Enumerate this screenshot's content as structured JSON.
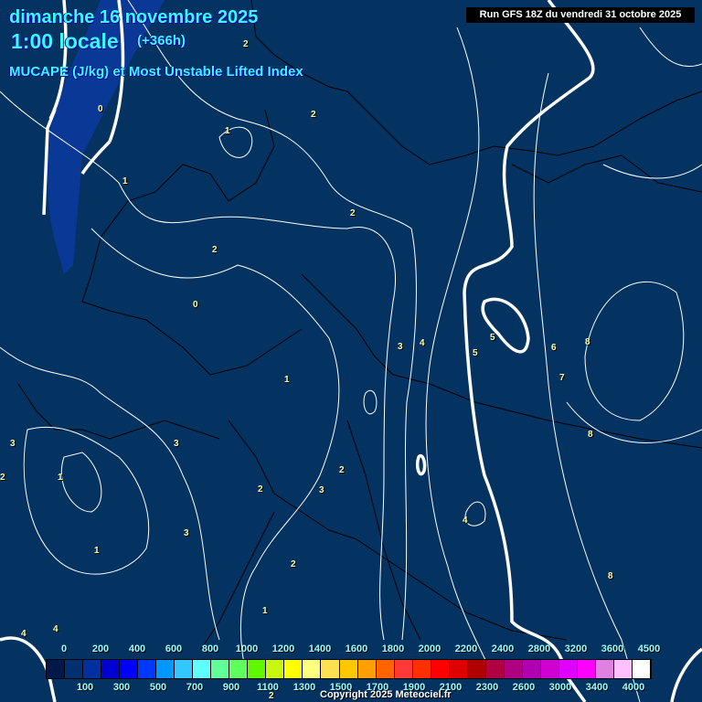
{
  "header": {
    "date": "dimanche 16 novembre 2025",
    "time": "1:00 locale",
    "lead": "(+366h)",
    "parameter": "MUCAPE (J/kg) et Most Unstable Lifted Index",
    "run": "Run GFS 18Z du vendredi 31 octobre 2025"
  },
  "contour_labels": [
    {
      "t": "2"
    },
    {
      "t": "0"
    },
    {
      "t": "2"
    },
    {
      "t": "1"
    },
    {
      "t": "1"
    },
    {
      "t": "2"
    },
    {
      "t": "2"
    },
    {
      "t": "0"
    },
    {
      "t": "1"
    },
    {
      "t": "3"
    },
    {
      "t": "4"
    },
    {
      "t": "5"
    },
    {
      "t": "5"
    },
    {
      "t": "6"
    },
    {
      "t": "8"
    },
    {
      "t": "7"
    },
    {
      "t": "8"
    },
    {
      "t": "3"
    },
    {
      "t": "3"
    },
    {
      "t": "1"
    },
    {
      "t": "2"
    },
    {
      "t": "2"
    },
    {
      "t": "2"
    },
    {
      "t": "3"
    },
    {
      "t": "3"
    },
    {
      "t": "1"
    },
    {
      "t": "2"
    },
    {
      "t": "4"
    },
    {
      "t": "8"
    },
    {
      "t": "1"
    },
    {
      "t": "4"
    },
    {
      "t": "4"
    },
    {
      "t": "2"
    }
  ],
  "legend": {
    "colors": [
      "#001848",
      "#003070",
      "#0030a0",
      "#0000d0",
      "#0000ff",
      "#0038ff",
      "#0098ff",
      "#30c8ff",
      "#60ffff",
      "#60ff98",
      "#60ff60",
      "#60f800",
      "#c8f810",
      "#ffff00",
      "#ffff80",
      "#ffe050",
      "#ffc800",
      "#ffa000",
      "#ff6400",
      "#ff3838",
      "#ff3000",
      "#ff0000",
      "#e00000",
      "#b00000",
      "#b00040",
      "#b00080",
      "#b000b0",
      "#d000d0",
      "#e000ff",
      "#ff00ff",
      "#e080e0",
      "#ffc0ff",
      "#ffffff"
    ],
    "top_labels": [
      "0",
      "200",
      "400",
      "600",
      "800",
      "1000",
      "1200",
      "1400",
      "1600",
      "1800",
      "2000",
      "2200",
      "2400",
      "2800",
      "3200",
      "3600",
      "4500"
    ],
    "bottom_labels": [
      "100",
      "300",
      "500",
      "700",
      "900",
      "1100",
      "1300",
      "1500",
      "1700",
      "1900",
      "2100",
      "2300",
      "2600",
      "3000",
      "3400",
      "4000"
    ]
  },
  "copyright": "Copyright 2025 Meteociel.fr"
}
